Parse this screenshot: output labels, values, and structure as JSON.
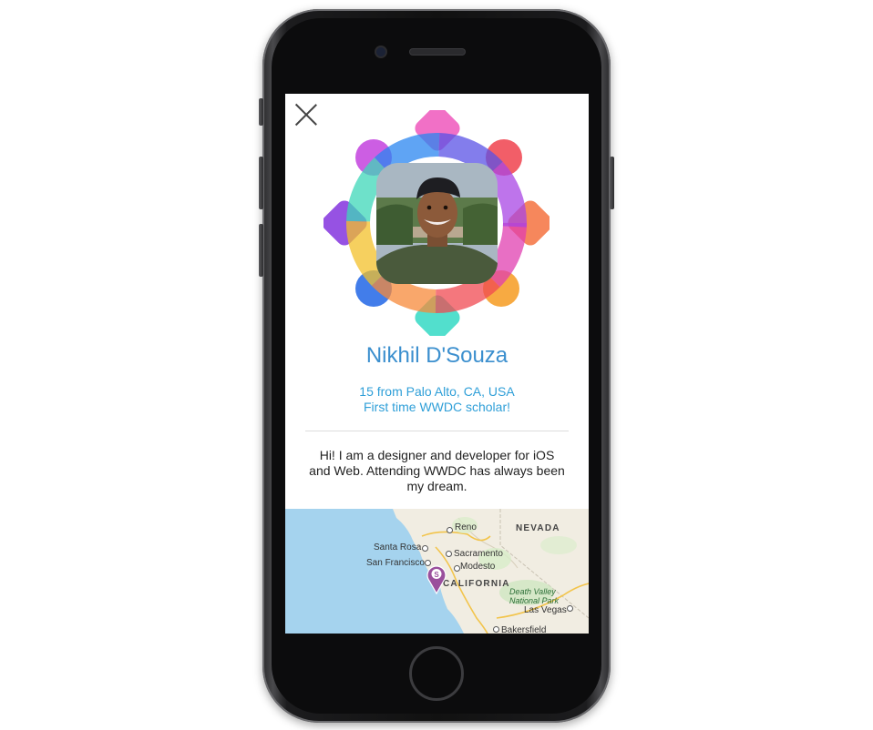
{
  "profile": {
    "name": "Nikhil D'Souza",
    "details": [
      "15 from Palo Alto, CA, USA",
      "First time WWDC scholar!"
    ],
    "bio": "Hi! I am a designer and developer for iOS and Web. Attending WWDC has always been my dream."
  },
  "map": {
    "labels": {
      "reno": "Reno",
      "nevada": "NEVADA",
      "santa_rosa": "Santa Rosa",
      "sacramento": "Sacramento",
      "san_francisco": "San Francisco",
      "modesto": "Modesto",
      "california": "CALIFORNIA",
      "death_valley": "Death Valley National Park",
      "las_vegas": "Las Vegas",
      "bakersfield": "Bakersfield"
    },
    "pin_letter": "S",
    "pin_color": "#9a4f9c",
    "water_color": "#a5d3ee",
    "land_color": "#f1ede2"
  },
  "colors": {
    "name": "#3b8fce",
    "subtitle": "#2f9fd8"
  }
}
